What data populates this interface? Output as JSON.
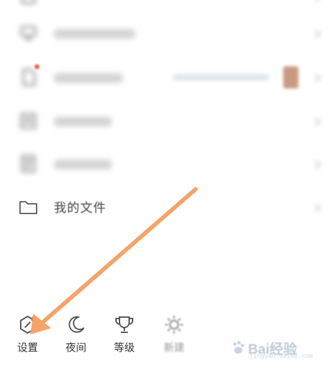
{
  "menu": {
    "items": [
      {
        "label": "我的文件"
      }
    ]
  },
  "toolbar": {
    "items": [
      {
        "label": "设置",
        "icon": "settings-hex-icon"
      },
      {
        "label": "夜间",
        "icon": "moon-icon"
      },
      {
        "label": "等级",
        "icon": "trophy-icon"
      },
      {
        "label": "新建",
        "icon": "sun-icon"
      }
    ]
  },
  "colors": {
    "badge": "#f05a4a",
    "arrow": "#f4a468",
    "icon": "#555555"
  }
}
